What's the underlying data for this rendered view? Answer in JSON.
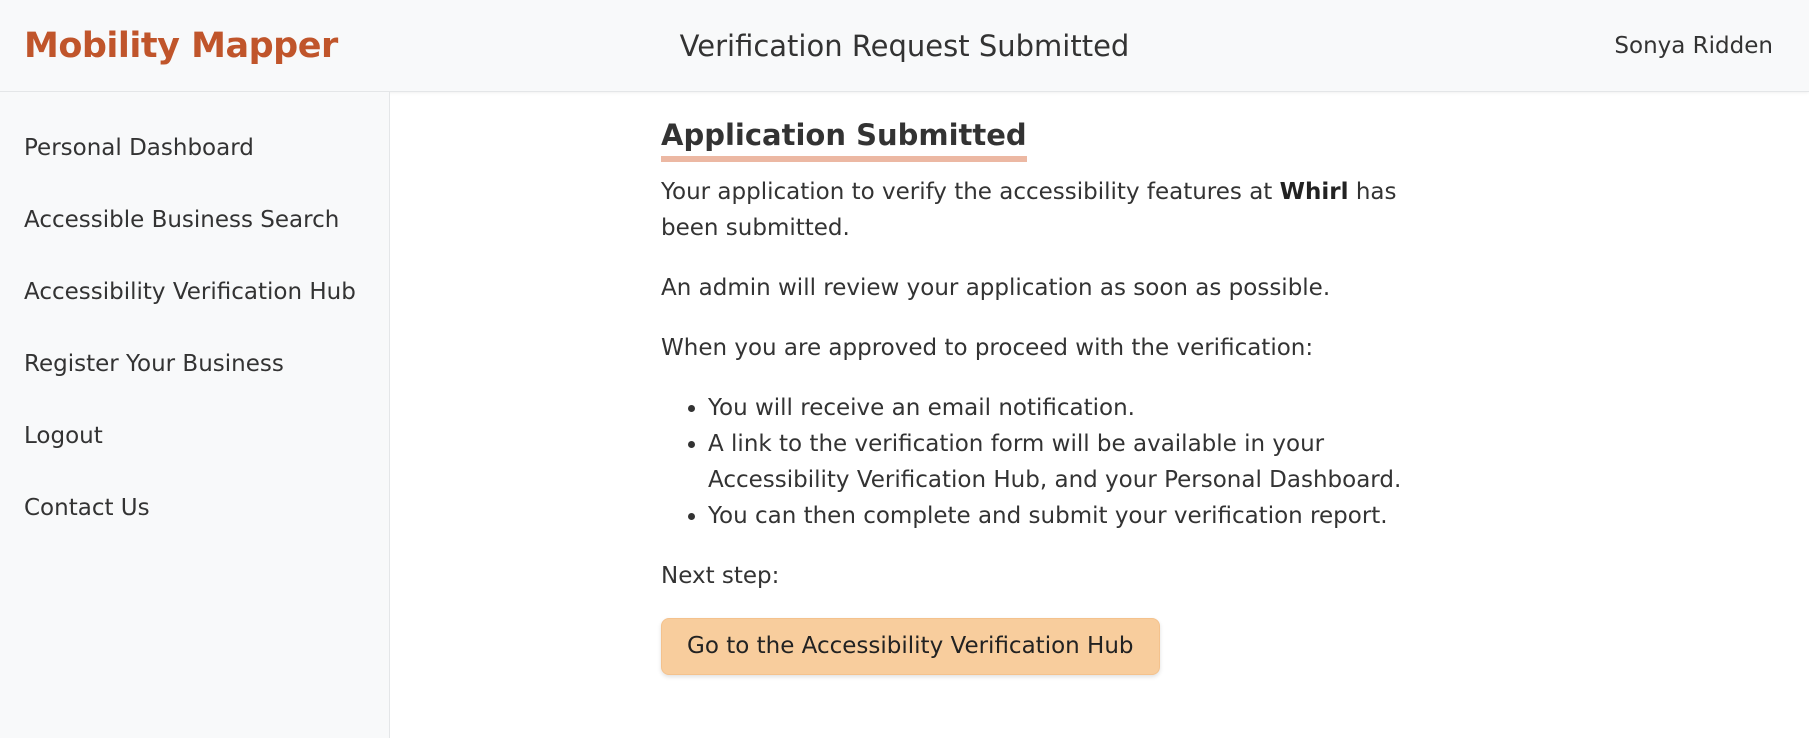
{
  "header": {
    "logo": "Mobility Mapper",
    "title": "Verification Request Submitted",
    "user": "Sonya Ridden"
  },
  "sidebar": {
    "items": [
      {
        "label": "Personal Dashboard"
      },
      {
        "label": "Accessible Business Search"
      },
      {
        "label": "Accessibility Verification Hub"
      },
      {
        "label": "Register Your Business"
      },
      {
        "label": "Logout"
      },
      {
        "label": "Contact Us"
      }
    ]
  },
  "main": {
    "heading": "Application Submitted",
    "intro_prefix": "Your application to verify the accessibility features at",
    "business_name": "Whirl",
    "intro_suffix": "has been submitted.",
    "review_text": "An admin will review your application as soon as possible.",
    "approved_text": "When you are approved to proceed with the verification:",
    "bullets": [
      "You will receive an email notification.",
      "A link to the verification form will be available in your Accessibility Verification Hub, and your Personal Dashboard.",
      "You can then complete and submit your verification report."
    ],
    "next_step_label": "Next step:",
    "cta_label": "Go to the Accessibility Verification Hub"
  },
  "colors": {
    "brand": "#c0552b",
    "heading_underline": "#ecb8a3",
    "cta_background": "#f8cd9d",
    "chrome_background": "#f8f9fa"
  }
}
